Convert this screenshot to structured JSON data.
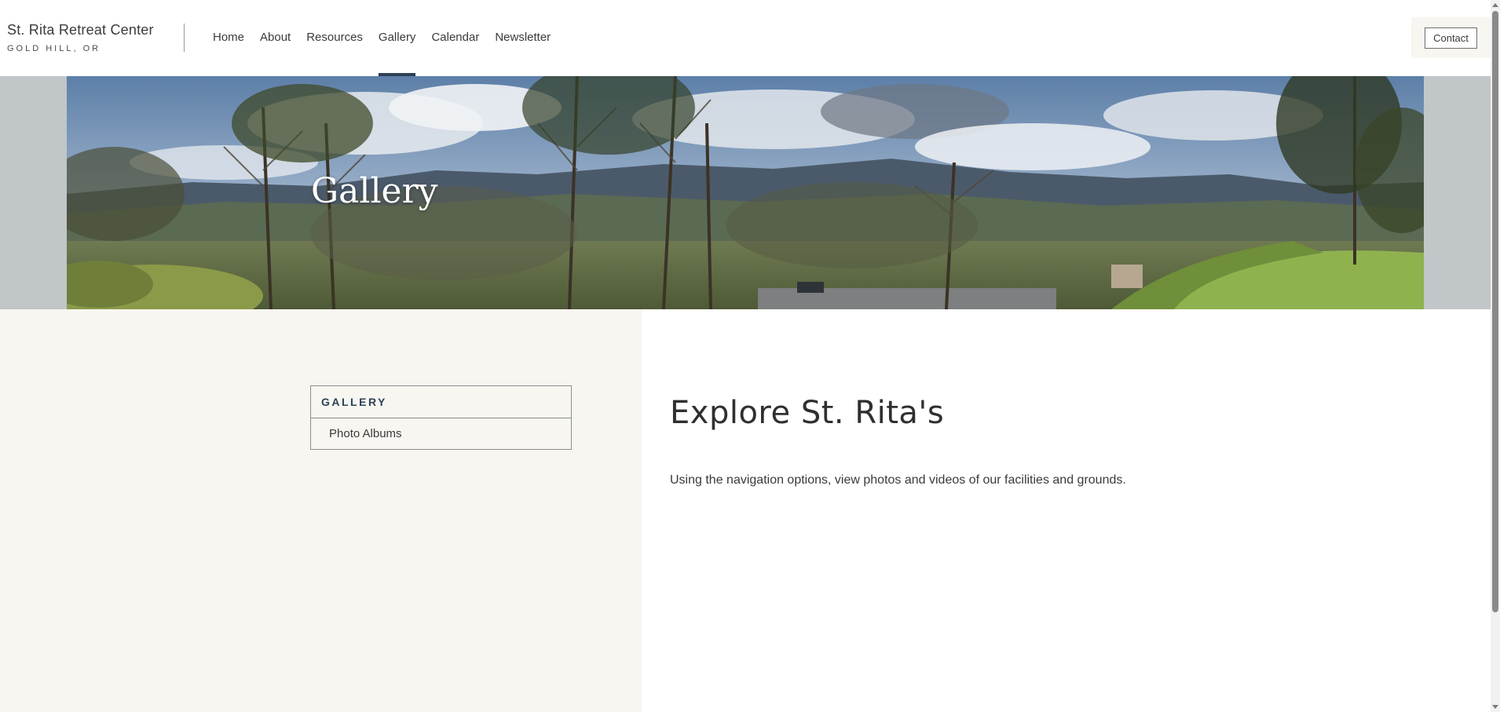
{
  "header": {
    "brand_name": "St. Rita Retreat Center",
    "brand_location": "GOLD HILL, OR",
    "nav": [
      {
        "label": "Home",
        "active": false
      },
      {
        "label": "About",
        "active": false
      },
      {
        "label": "Resources",
        "active": false
      },
      {
        "label": "Gallery",
        "active": true
      },
      {
        "label": "Calendar",
        "active": false
      },
      {
        "label": "Newsletter",
        "active": false
      }
    ],
    "contact_label": "Contact"
  },
  "hero": {
    "title": "Gallery",
    "image_icon": "landscape-photo"
  },
  "sidebar": {
    "heading": "GALLERY",
    "items": [
      {
        "label": "Photo Albums"
      }
    ]
  },
  "main": {
    "title": "Explore St. Rita's",
    "body": "Using the navigation options, view photos and videos of our facilities and grounds."
  },
  "colors": {
    "accent": "#2d4157",
    "panel_bg": "#f8f6f1",
    "hero_band": "#c1c6c8"
  }
}
